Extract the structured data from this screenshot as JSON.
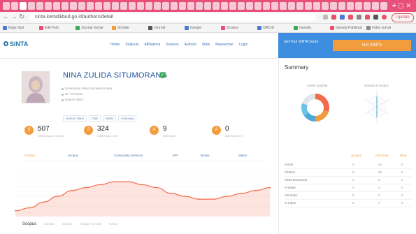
{
  "browser": {
    "url": "sinta.kemdikbud.go.id/authors/detail",
    "profile_button": "Update",
    "bookmarks": [
      "Edge Stat",
      "Edit Foto",
      "Journal Jurnal",
      "Scholar",
      "Journal",
      "Google",
      "Scopus",
      "ORCID",
      "Garuda",
      "Garuda Publikasi",
      "Index Jurnal"
    ]
  },
  "app": {
    "logo": "SINTA",
    "top_nav": [
      "Home",
      "Subjects",
      "Affiliations",
      "Sources",
      "Authors",
      "Stats",
      "Researcher",
      "Login"
    ],
    "signup_text": "Get Your SINTA Score",
    "cta_label": "Get SINTA"
  },
  "profile": {
    "name": "NINA ZULIDA SITUMORANG",
    "affiliation_lines": [
      "Universitas Islam Sumatera Utara",
      "ID : 6741234",
      "Hukum Islam"
    ],
    "tags": [
      "Hukum Islam",
      "Fiqh",
      "Waris",
      "Keluarga"
    ],
    "stats": [
      {
        "icon": "S",
        "value": "507",
        "label": "SINTA Score Overall"
      },
      {
        "icon": "3",
        "value": "324",
        "label": "SINTA Score 3Yr"
      },
      {
        "icon": "A",
        "value": "9",
        "label": "Affil Score"
      },
      {
        "icon": "A",
        "value": "0",
        "label": "Affil Score 3Yr"
      }
    ],
    "tabs": [
      {
        "label": "Articles",
        "active": true
      },
      {
        "label": "Scopus",
        "active": false
      },
      {
        "label": "Community Services",
        "active": false
      },
      {
        "label": "IPR",
        "active": false
      },
      {
        "label": "Books",
        "active": false
      },
      {
        "label": "Matrix",
        "active": false
      }
    ]
  },
  "bottom_nav": {
    "title": "Scopus",
    "items": [
      "Scholar",
      "Garuda",
      "Google Scholar",
      "Rama"
    ]
  },
  "summary": {
    "title": "Summary",
    "donut_label": "Article Quartile",
    "radar_label": "Research Output",
    "table_head": [
      "Scopus",
      "GScholar",
      "WoS"
    ],
    "rows": [
      {
        "label": "Article",
        "values": [
          "0",
          "40",
          "0"
        ]
      },
      {
        "label": "Citation",
        "values": [
          "0",
          "56",
          "0"
        ]
      },
      {
        "label": "Cited Document",
        "values": [
          "0",
          "8",
          "0"
        ]
      },
      {
        "label": "H-Index",
        "values": [
          "0",
          "4",
          "0"
        ]
      },
      {
        "label": "i10-Index",
        "values": [
          "0",
          "2",
          "0"
        ]
      },
      {
        "label": "G-Index",
        "values": [
          "0",
          "1",
          "0"
        ]
      }
    ]
  },
  "chart_data": {
    "type": "area",
    "title": "",
    "series": [
      {
        "values": [
          2,
          3,
          5,
          7,
          9,
          10,
          11,
          12,
          12,
          11,
          10,
          8,
          7,
          6,
          6,
          7,
          8,
          9,
          10
        ]
      }
    ],
    "ylim": [
      0,
      14
    ],
    "grid": true,
    "color": "#f26b4b"
  },
  "donut_data": {
    "type": "pie",
    "values": [
      30,
      20,
      15,
      15,
      20
    ],
    "colors": [
      "#f26b4b",
      "#f39c3d",
      "#4fa8d8",
      "#6ac1ea",
      "#e2e6ea"
    ]
  },
  "colors": {
    "accent": "#f39c3d",
    "brand": "#3d8ee0",
    "link": "#1e4fa0"
  }
}
